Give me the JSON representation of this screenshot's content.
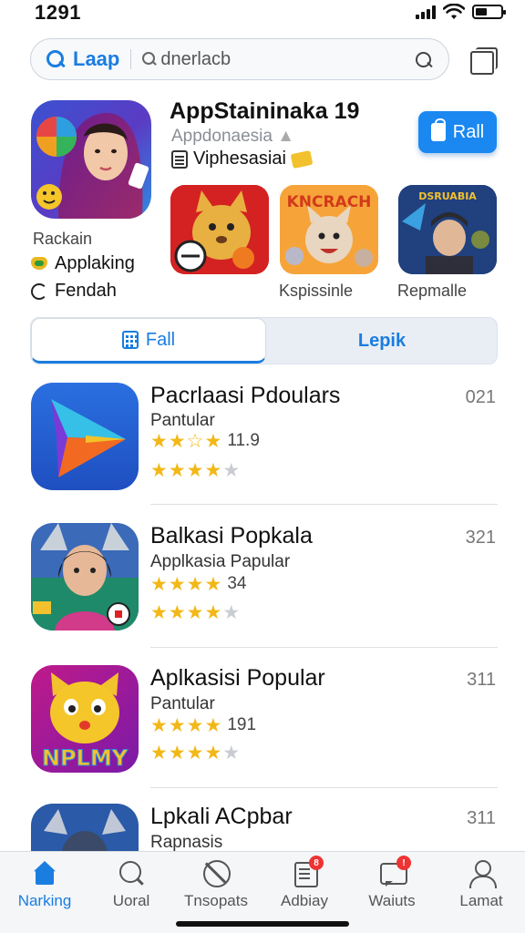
{
  "status": {
    "time": "1291"
  },
  "search": {
    "label": "Laap",
    "placeholder": "dnerlacb"
  },
  "featured": {
    "title": "AppStaininaka 19",
    "subtitle": "Appdonaesia",
    "line": "Viphesasiai",
    "button": "Rall",
    "side_label": "Rackain",
    "side_row_1": "Applaking",
    "side_row_2": "Fendah",
    "thumb_labels": [
      "",
      "Kspissinle",
      "Repmalle"
    ]
  },
  "segment": {
    "active": "Fall",
    "inactive": "Lepik"
  },
  "list": [
    {
      "name": "Pacrlaasi Pdoulars",
      "category": "Pantular",
      "rating": "11.9",
      "stars_top": 3.5,
      "stars_bottom": 4,
      "count": "021"
    },
    {
      "name": "Balkasi Popkala",
      "category": "Applkasia Papular",
      "rating": "34",
      "stars_top": 3.5,
      "stars_bottom": 4,
      "count": "321"
    },
    {
      "name": "Aplkasisi Popular",
      "category": "Pantular",
      "rating": "191",
      "stars_top": 3.5,
      "stars_bottom": 3.5,
      "count": "311"
    },
    {
      "name": "Lpkali ACpbar",
      "category": "Rapnasis",
      "count": "311"
    }
  ],
  "tabs": [
    {
      "label": "Narking",
      "icon": "home-icon",
      "active": true
    },
    {
      "label": "Uoral",
      "icon": "search-icon",
      "active": false
    },
    {
      "label": "Tnsopats",
      "icon": "ban-icon",
      "active": false
    },
    {
      "label": "Adbiay",
      "icon": "document-icon",
      "active": false,
      "badge": "8"
    },
    {
      "label": "Waiuts",
      "icon": "message-icon",
      "active": false,
      "badge": "!"
    },
    {
      "label": "Lamat",
      "icon": "user-icon",
      "active": false
    }
  ],
  "colors": {
    "accent": "#1a7de0",
    "star": "#f2b818"
  }
}
